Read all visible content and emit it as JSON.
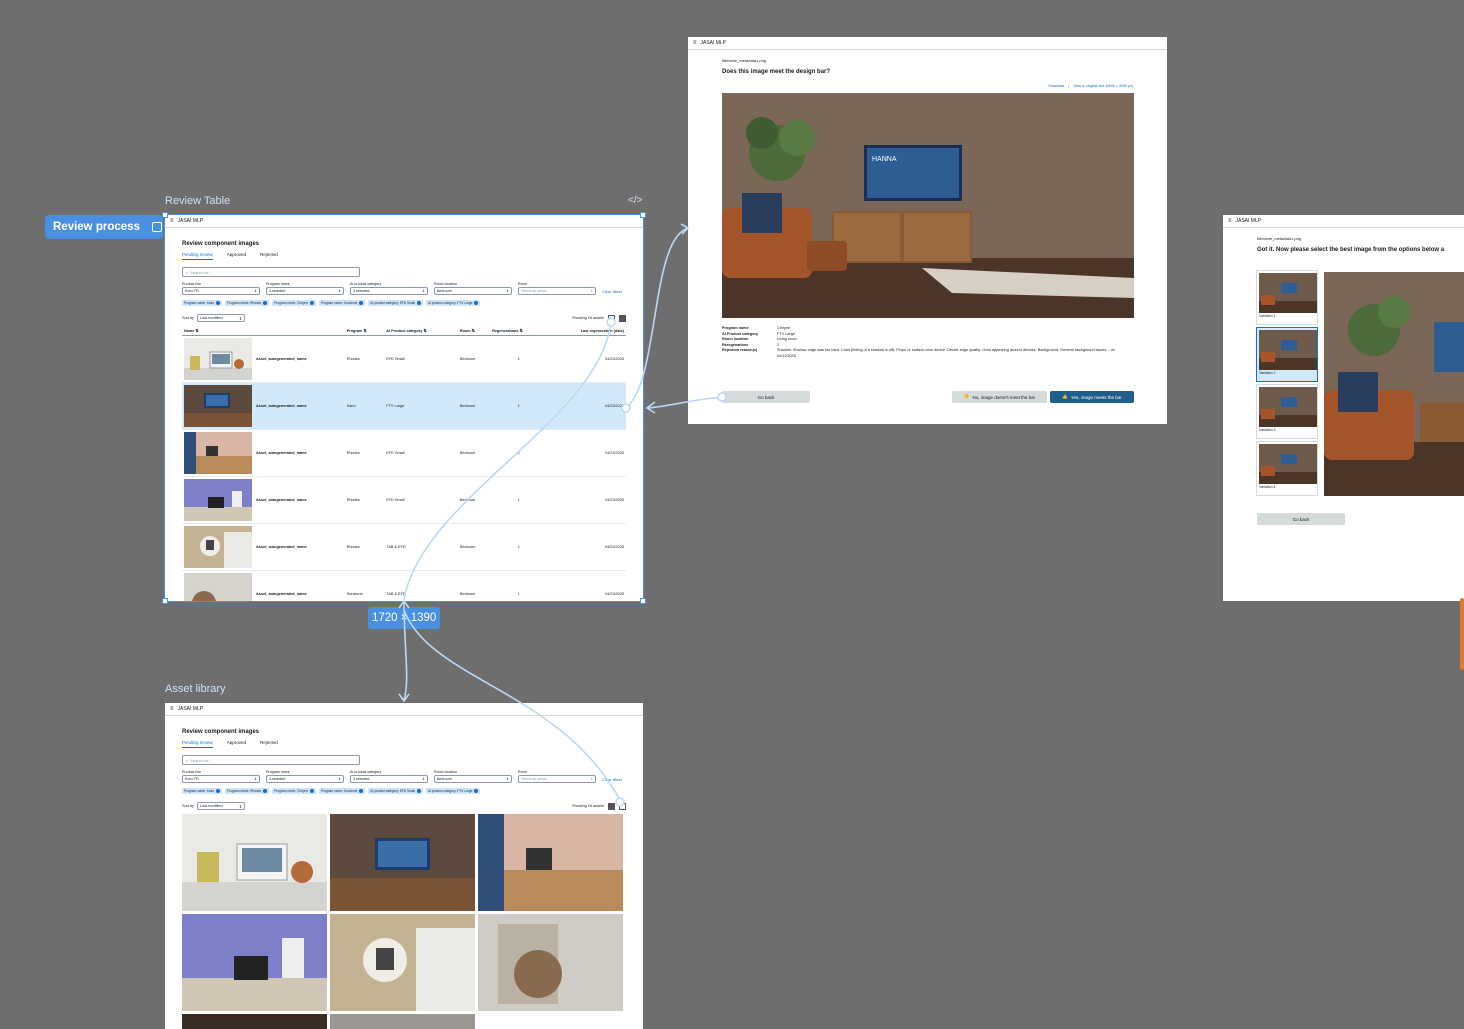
{
  "canvas": {
    "flow_label": "Review process",
    "size_badge": "1720 × 1390",
    "review_table_title": "Review Table",
    "asset_library_title": "Asset library"
  },
  "app": {
    "name": "JASAI MLP"
  },
  "review_table": {
    "heading": "Review component images",
    "tabs": [
      "Pending review",
      "Approved",
      "Rejected"
    ],
    "search_placeholder": "Search for...",
    "filters": [
      {
        "label": "Product line",
        "value": "Echo FD"
      },
      {
        "label": "Program name",
        "value": "4 selected"
      },
      {
        "label": "AI product category",
        "value": "3 selected"
      },
      {
        "label": "Room location",
        "value": "Bedroom"
      },
      {
        "label": "Event",
        "value": "Select an option"
      }
    ],
    "clear_filters": "Clear filters",
    "chips": [
      "Program name: Kairo",
      "Program name: Rhodes",
      "Program name: Cheyne",
      "Program name: Sunstone",
      "AI product category: EFD Small",
      "AI product category: FTV Large"
    ],
    "sort_label": "Sort by",
    "sort_value": "Last modified",
    "showing": "Showing 16 assets",
    "columns": [
      "Name ⇅",
      "Program ⇅",
      "AI Product category ⇅",
      "Room ⇅",
      "Regenerations ⇅",
      "Last regeneration (date)"
    ],
    "rows": [
      {
        "name": "Asset_autogenerated_name",
        "program": "Rhodes",
        "category": "EFD Small",
        "room": "Bedroom",
        "regen": "1",
        "date": "04/23/2025"
      },
      {
        "name": "Asset_autogenerated_name",
        "program": "Kairo",
        "category": "FTV Large",
        "room": "Bedroom",
        "regen": "1",
        "date": "04/23/2025"
      },
      {
        "name": "Asset_autogenerated_name",
        "program": "Rhodes",
        "category": "EFD Small",
        "room": "Bedroom",
        "regen": "1",
        "date": "04/23/2025"
      },
      {
        "name": "Asset_autogenerated_name",
        "program": "Rhodes",
        "category": "EFD Small",
        "room": "Bedroom",
        "regen": "1",
        "date": "04/23/2025"
      },
      {
        "name": "Asset_autogenerated_name",
        "program": "Rhodes",
        "category": "TAB & EFD",
        "room": "Bedroom",
        "regen": "1",
        "date": "04/23/2025"
      },
      {
        "name": "Asset_autogenerated_name",
        "program": "Sunstone",
        "category": "TAB & EFD",
        "room": "Bedroom",
        "regen": "1",
        "date": "04/23/2025"
      }
    ]
  },
  "design_review": {
    "filename": "filename_metadata1.png",
    "question": "Does this image meet the design bar?",
    "download": "Download",
    "view_original": "View in original size (8000 × 4000 px)",
    "tv_text": "HANNA",
    "meta": [
      {
        "key": "Program name",
        "value": "Cheyne"
      },
      {
        "key": "AI Product category",
        "value": "FTV Large"
      },
      {
        "key": "Room location",
        "value": "Living room"
      },
      {
        "key": "Reregenations",
        "value": "2"
      },
      {
        "key": "Rejection reason(s)",
        "value": "Shadow: Shadow edge was too hard. Color (tinting of a shadow is off). Props or surface near device. Device edge quality: Glow appearing around devices. Background: General background issues. - on 04/11/2025"
      }
    ],
    "go_back": "Go back",
    "reject": "No, image doesn't meet the bar",
    "approve": "Yes, image meets the bar"
  },
  "variation_select": {
    "filename": "filename_metadata1.png",
    "prompt": "Got it. Now please select the best image from the options below a",
    "variations": [
      "Variation 1",
      "Variation 2",
      "Variation 3",
      "Variation 4"
    ],
    "go_back": "Go back"
  },
  "colors": {
    "canvas": "#6e6e6e",
    "accent": "#4a90e2",
    "selected_row": "#d3e9fb",
    "primary_button": "#1f5d8c"
  }
}
